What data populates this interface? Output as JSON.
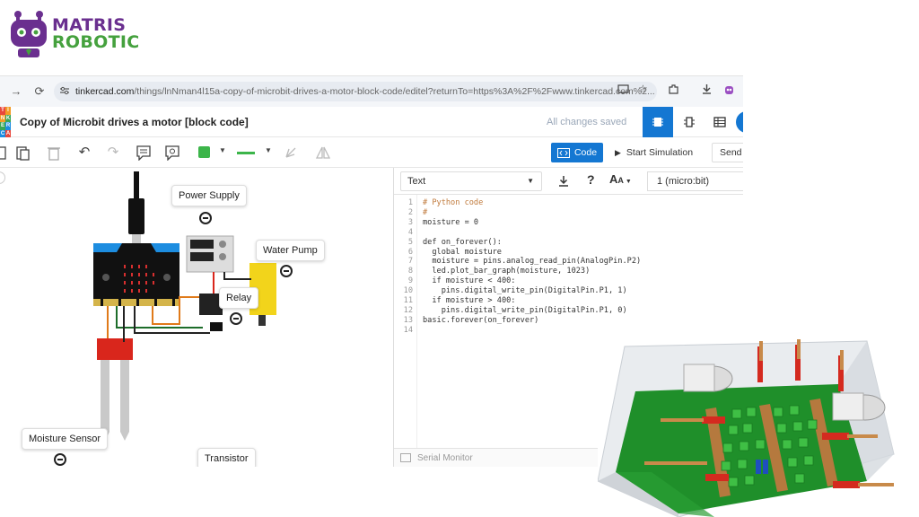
{
  "logo": {
    "line1": "MATRIS",
    "line2": "ROBOTIC"
  },
  "browser": {
    "url_host": "tinkercad.com",
    "url_path": "/things/lnNman4l15a-copy-of-microbit-drives-a-motor-block-code/editel?returnTo=https%3A%2F%2Fwww.tinkercad.com%2..."
  },
  "app": {
    "logo_letters": [
      "T",
      "I",
      "N",
      "K",
      "E",
      "R",
      "C",
      "A",
      "D"
    ],
    "title": "Copy of Microbit drives a motor [block code]",
    "save_status": "All changes saved",
    "code_button": "Code",
    "simulate_button": "Start Simulation",
    "send_button": "Send",
    "accent": "#1477d2"
  },
  "workspace": {
    "callouts": {
      "power_supply": "Power Supply",
      "water_pump": "Water Pump",
      "relay": "Relay",
      "moisture_sensor": "Moisture Sensor",
      "transistor": "Transistor"
    }
  },
  "code_panel": {
    "mode": "Text",
    "device": "1 (micro:bit)",
    "serial_monitor": "Serial Monitor",
    "line_numbers": [
      "1",
      "2",
      "3",
      "4",
      "5",
      "6",
      "7",
      "8",
      "9",
      "10",
      "11",
      "12",
      "13",
      "14"
    ],
    "lines": [
      "# Python code",
      "#",
      "moisture = 0",
      "",
      "def on_forever():",
      "  global moisture",
      "  moisture = pins.analog_read_pin(AnalogPin.P2)",
      "  led.plot_bar_graph(moisture, 1023)",
      "  if moisture < 400:",
      "    pins.digital_write_pin(DigitalPin.P1, 1)",
      "  if moisture > 400:",
      "    pins.digital_write_pin(DigitalPin.P1, 0)",
      "basic.forever(on_forever)",
      ""
    ]
  }
}
